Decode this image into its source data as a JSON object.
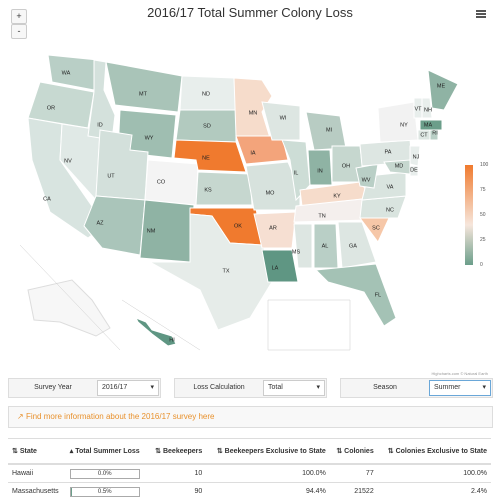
{
  "title": "2016/17 Total Summer Colony Loss",
  "zoom": {
    "in": "+",
    "out": "-"
  },
  "icons": {
    "menu": "hamburger-menu-icon",
    "link": "external-link-icon",
    "sort": "sort-icon"
  },
  "colors": {
    "high": "#f07a2e",
    "mid": "#f6e6dc",
    "low": "#6b9e8a",
    "grid": "#cfd8d5"
  },
  "legend": {
    "ticks": [
      "100",
      "75",
      "50",
      "25",
      "0"
    ]
  },
  "credits": "Highcharts.com © Natural Earth",
  "controls": [
    {
      "label": "Survey Year",
      "value": "2016/17"
    },
    {
      "label": "Loss Calculation",
      "value": "Total"
    },
    {
      "label": "Season",
      "value": "Summer"
    }
  ],
  "info_link": "Find more information about the 2016/17 survey here",
  "table": {
    "headers": [
      "State",
      "Total Summer Loss",
      "Beekeepers",
      "Beekeepers Exclusive to State",
      "Colonies",
      "Colonies Exclusive to State"
    ],
    "rows": [
      {
        "state": "Hawaii",
        "loss": "0.0%",
        "loss_value": 0.0,
        "beekeepers": "10",
        "bk_excl": "100.0%",
        "colonies": "77",
        "col_excl": "100.0%"
      },
      {
        "state": "Massachusetts",
        "loss": "0.5%",
        "loss_value": 0.5,
        "beekeepers": "90",
        "bk_excl": "94.4%",
        "colonies": "21522",
        "col_excl": "2.4%"
      }
    ]
  },
  "states": {
    "WA": "WA",
    "OR": "OR",
    "CA": "CA",
    "NV": "NV",
    "ID": "ID",
    "MT": "MT",
    "WY": "WY",
    "UT": "UT",
    "AZ": "AZ",
    "CO": "CO",
    "NM": "NM",
    "ND": "ND",
    "SD": "SD",
    "NE": "NE",
    "KS": "KS",
    "OK": "OK",
    "TX": "TX",
    "MN": "MN",
    "IA": "IA",
    "MO": "MO",
    "AR": "AR",
    "LA": "LA",
    "WI": "WI",
    "IL": "IL",
    "MI": "MI",
    "IN": "IN",
    "OH": "OH",
    "KY": "KY",
    "TN": "TN",
    "MS": "MS",
    "AL": "AL",
    "GA": "GA",
    "FL": "FL",
    "SC": "SC",
    "NC": "NC",
    "VA": "VA",
    "WV": "WV",
    "PA": "PA",
    "NY": "NY",
    "VT": "VT",
    "NH": "NH",
    "ME": "ME",
    "MA": "MA",
    "CT": "CT",
    "RI": "RI",
    "NJ": "NJ",
    "DE": "DE",
    "MD": "MD",
    "HI": "HI"
  }
}
